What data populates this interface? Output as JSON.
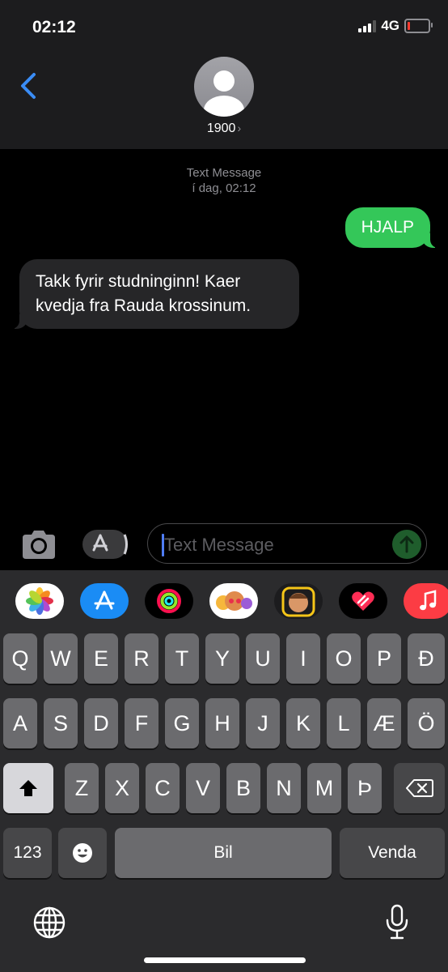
{
  "status_bar": {
    "time": "02:12",
    "network": "4G",
    "battery_color": "#ff3b30"
  },
  "contact": {
    "name": "1900",
    "chevron": "›"
  },
  "conversation": {
    "service": "Text Message",
    "timestamp": "í dag, 02:12",
    "messages": [
      {
        "direction": "outgoing",
        "text": "HJALP",
        "color": "#34c759"
      },
      {
        "direction": "incoming",
        "text": "Takk fyrir studninginn! Kaer kvedja fra Rauda krossinum.",
        "color": "#262628"
      }
    ]
  },
  "composer": {
    "placeholder": "Text Message"
  },
  "app_strip": [
    {
      "name": "photos-app-icon"
    },
    {
      "name": "app-store-icon"
    },
    {
      "name": "activity-icon"
    },
    {
      "name": "animoji-stickers-icon"
    },
    {
      "name": "memoji-icon"
    },
    {
      "name": "digital-touch-icon"
    },
    {
      "name": "music-icon"
    }
  ],
  "keyboard": {
    "row1": [
      "Q",
      "W",
      "E",
      "R",
      "T",
      "Y",
      "U",
      "I",
      "O",
      "P",
      "Ð"
    ],
    "row2": [
      "A",
      "S",
      "D",
      "F",
      "G",
      "H",
      "J",
      "K",
      "L",
      "Æ",
      "Ö"
    ],
    "row3": [
      "Z",
      "X",
      "C",
      "V",
      "B",
      "N",
      "M",
      "Þ"
    ],
    "numbers_label": "123",
    "space_label": "Bil",
    "return_label": "Venda"
  }
}
